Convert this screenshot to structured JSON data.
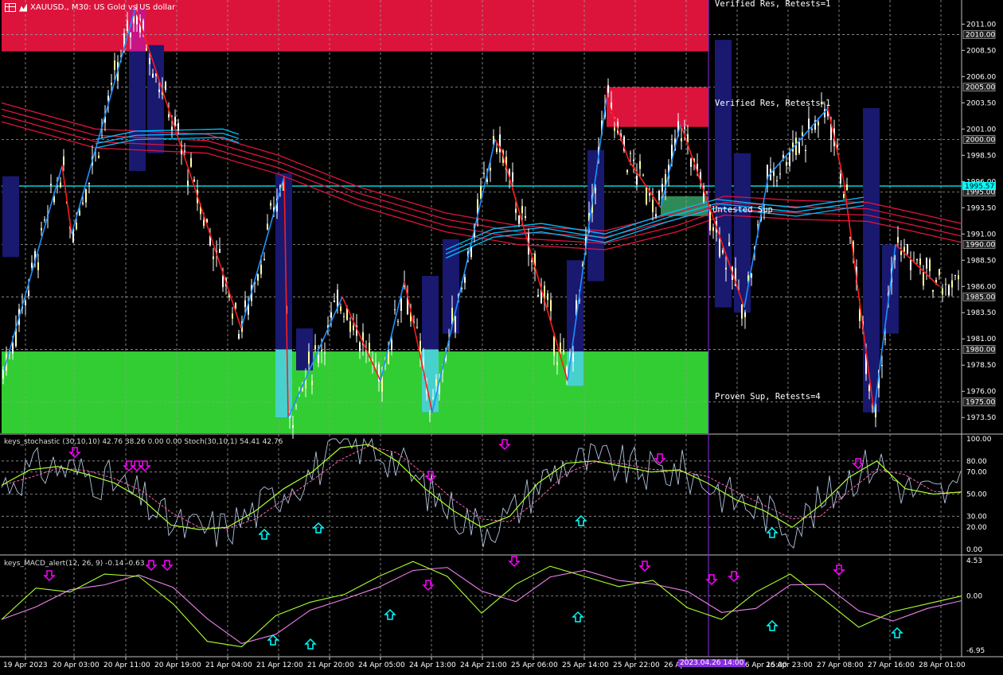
{
  "colors": {
    "background": "#000000",
    "grid": "#9a9a9a",
    "zone_resistance": "#dc143c",
    "zone_support": "#32cd32",
    "zone_untested": "#2e8b57",
    "zigzag_up": "#1e90ff",
    "zigzag_down": "#ff1a1a",
    "candle_bull": "#ffffff",
    "candle_bull_body": "#ffff99",
    "candle_bear": "#ffffff",
    "ma_red": "#dc143c",
    "ma_blue": "#00bfff",
    "fractal_bar": "#191970",
    "price_line": "#00ffff",
    "vline": "#8a2be2",
    "stoch_main": "#adff2f",
    "stoch_signal": "#ff69b4",
    "stoch_raw": "#b0c4de",
    "arrow_down": "#ff00ff",
    "arrow_up": "#00ffff"
  },
  "header": {
    "symbol_text": "XAUUSD., M30:  US Gold vs US dollar"
  },
  "main_chart": {
    "zones": {
      "verified_res_1": "Verified Res, Retests=1",
      "verified_res_2": "Verified Res, Retests=1",
      "untested_sup": "Untested Sup",
      "proven_sup": "Proven Sup, Retests=4"
    },
    "price_axis": [
      "2011.00",
      "2008.50",
      "2006.00",
      "2003.50",
      "2001.00",
      "1998.50",
      "1996.00",
      "1993.50",
      "1991.00",
      "1988.50",
      "1986.00",
      "1983.50",
      "1981.00",
      "1978.50",
      "1976.00",
      "1973.50"
    ],
    "boxed_levels": [
      "2010.00",
      "2005.00",
      "2000.00",
      "1995.00",
      "1990.00",
      "1985.00",
      "1980.00",
      "1975.00"
    ],
    "current_price": "1995.57",
    "ylim": [
      1972.0,
      2013.3
    ]
  },
  "stoch_panel": {
    "title": "keys_stochastic (30,10,10) 42.76 38.26 0.00 0.00 Stoch(30,10,1) 54.41 42.76",
    "axis": [
      "100.00",
      "80.00",
      "70.00",
      "50.00",
      "30.00",
      "20.00",
      "0.00"
    ]
  },
  "macd_panel": {
    "title": "keys_MACD_alert(12, 26, 9) -0.14 -0.63",
    "axis": [
      "4.53",
      "0.00",
      "-6.95"
    ]
  },
  "time_axis": [
    "19 Apr 2023",
    "20 Apr 03:00",
    "20 Apr 11:00",
    "20 Apr 19:00",
    "21 Apr 04:00",
    "21 Apr 12:00",
    "21 Apr 20:00",
    "24 Apr 05:00",
    "24 Apr 13:00",
    "24 Apr 21:00",
    "25 Apr 06:00",
    "25 Apr 14:00",
    "25 Apr 22:00",
    "26 Apr",
    "26 Apr 15:00",
    "26 Apr 23:00",
    "27 Apr 08:00",
    "27 Apr 16:00",
    "28 Apr 01:00"
  ],
  "cursor_time": "2023.04.26 14:00",
  "chart_data": {
    "type": "line",
    "title": "XAUUSD., M30:  US Gold vs US dollar",
    "xlabel": "",
    "ylabel": "",
    "ylim": [
      1972.0,
      2013.3
    ],
    "zigzag": {
      "x": [
        "19 Apr 2023",
        "20 Apr 03:00",
        "20 Apr 06:00",
        "20 Apr 12:00",
        "21 Apr 04:00",
        "21 Apr 11:00",
        "21 Apr 13:00",
        "21 Apr 20:00",
        "24 Apr 02:00",
        "24 Apr 05:00",
        "24 Apr 11:00",
        "24 Apr 14:00",
        "24 Apr 21:00",
        "25 Apr 06:00",
        "25 Apr 14:00",
        "25 Apr 19:00",
        "25 Apr 23:00",
        "26 Apr 05:00",
        "26 Apr 14:00",
        "26 Apr 18:00",
        "27 Apr 08:00",
        "27 Apr 13:00",
        "27 Apr 17:00",
        "27 Apr 23:00",
        "28 Apr 01:00"
      ],
      "y": [
        1978.0,
        1997.5,
        1991.0,
        2012.5,
        1982.0,
        1996.5,
        1973.5,
        1985.0,
        1977.0,
        1986.5,
        1974.0,
        2000.0,
        1999.0,
        1977.0,
        2004.0,
        1998.0,
        1993.5,
        2001.5,
        1984.0,
        1996.5,
        2003.0,
        1996.0,
        1974.0,
        1990.0,
        1986.0
      ]
    },
    "stochastic_k": [
      58,
      72,
      75,
      68,
      60,
      45,
      22,
      18,
      20,
      35,
      55,
      70,
      92,
      95,
      80,
      55,
      35,
      20,
      30,
      60,
      78,
      80,
      75,
      70,
      72,
      60,
      45,
      35,
      20,
      40,
      65,
      80,
      55,
      50,
      52
    ],
    "macd_main": [
      -3,
      1,
      0.5,
      2.8,
      2.5,
      -1,
      -5.8,
      -6.5,
      -2.5,
      -0.8,
      0.2,
      2.5,
      4.4,
      2.5,
      -2.2,
      1.5,
      3.8,
      2.5,
      1.2,
      2,
      -1.5,
      -3,
      0.5,
      2.8,
      -0.5,
      -4,
      -2,
      -1,
      0
    ]
  }
}
